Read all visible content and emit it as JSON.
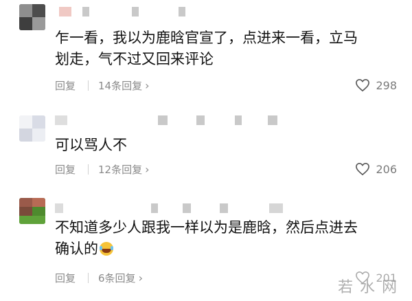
{
  "comments": [
    {
      "text_lines": [
        "乍一看，我以为鹿晗官宣了，点进来一看，立马",
        "划走，气不过又回来评论"
      ],
      "reply_label": "回复",
      "replies_link": "14条回复",
      "likes": "298"
    },
    {
      "text_lines": [
        "可以骂人不"
      ],
      "reply_label": "回复",
      "replies_link": "12条回复",
      "likes": "206"
    },
    {
      "text_lines": [
        "不知道多少人跟我一样以为是鹿晗，然后点进去",
        "确认的"
      ],
      "reply_label": "回复",
      "replies_link": "6条回复",
      "likes": "201"
    }
  ],
  "watermark": "若水网",
  "icons": {
    "like": "heart-outline-icon",
    "more": "chevron-right-icon"
  },
  "colors": {
    "text": "#111111",
    "meta": "#8a8a8a",
    "background": "#ffffff"
  }
}
